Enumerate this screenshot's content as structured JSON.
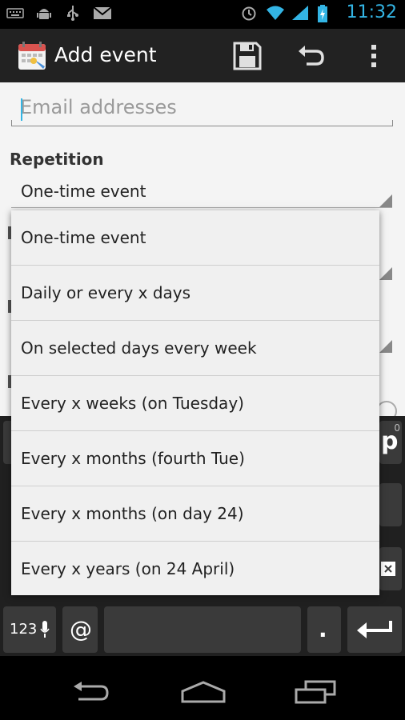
{
  "status_bar": {
    "time": "11:32"
  },
  "action_bar": {
    "title": "Add event"
  },
  "form": {
    "email_placeholder": "Email addresses",
    "repetition_label": "Repetition",
    "repetition_value": "One-time event"
  },
  "dropdown": {
    "options": [
      "One-time event",
      "Daily or every x days",
      "On selected days every week",
      "Every x weeks (on Tuesday)",
      "Every x months (fourth Tue)",
      "Every x months (on day 24)",
      "Every x years (on 24 April)"
    ]
  },
  "keyboard": {
    "symbols_key": "123",
    "at_key": "@",
    "period_key": ".",
    "partial_key_p": "p",
    "partial_key_zero": "0"
  },
  "colors": {
    "accent": "#33b5e5",
    "action_bar": "#222222",
    "content_bg": "#f4f4f4"
  }
}
